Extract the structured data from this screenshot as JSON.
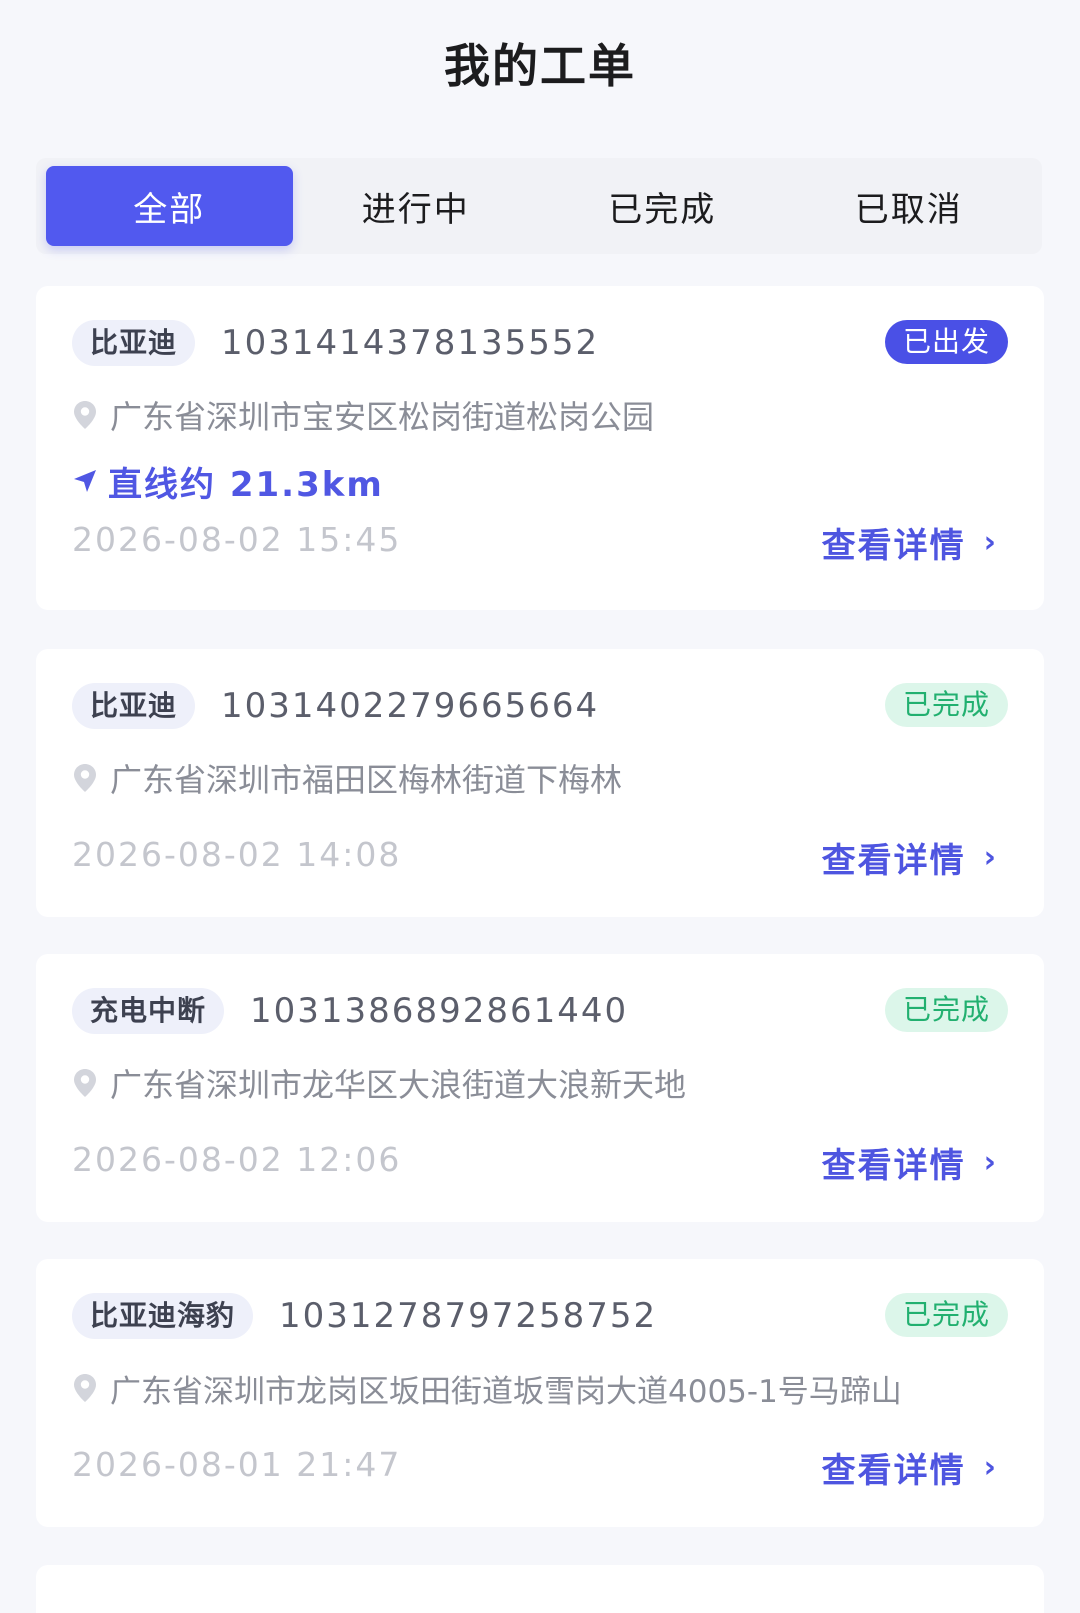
{
  "header": {
    "title": "我的工单"
  },
  "tabs": [
    {
      "label": "全部",
      "active": true
    },
    {
      "label": "进行中",
      "active": false
    },
    {
      "label": "已完成",
      "active": false
    },
    {
      "label": "已取消",
      "active": false
    }
  ],
  "orders": [
    {
      "tag": "比亚迪",
      "order_no": "1031414378135552",
      "status": "已出发",
      "address": "广东省深圳市宝安区松岗街道松岗公园",
      "distance": "直线约 21.3km",
      "time": "2026-08-02 15:45",
      "detail_label": "查看详情"
    },
    {
      "tag": "比亚迪",
      "order_no": "1031402279665664",
      "status": "已完成",
      "address": "广东省深圳市福田区梅林街道下梅林",
      "time": "2026-08-02 14:08",
      "detail_label": "查看详情"
    },
    {
      "tag": "充电中断",
      "order_no": "1031386892861440",
      "status": "已完成",
      "address": "广东省深圳市龙华区大浪街道大浪新天地",
      "time": "2026-08-02 12:06",
      "detail_label": "查看详情"
    },
    {
      "tag": "比亚迪海豹",
      "order_no": "1031278797258752",
      "status": "已完成",
      "address": "广东省深圳市龙岗区坂田街道坂雪岗大道4005-1号马蹄山",
      "time": "2026-08-01 21:47",
      "detail_label": "查看详情"
    }
  ],
  "colors": {
    "accent": "#5159ef",
    "status_departed_bg": "#4a50e6",
    "status_done_bg": "#dcf6ea",
    "status_done_text": "#22b070"
  },
  "icons": {
    "location": "location-pin-icon",
    "distance": "navigation-arrow-icon",
    "chevron": "chevron-right-icon"
  }
}
